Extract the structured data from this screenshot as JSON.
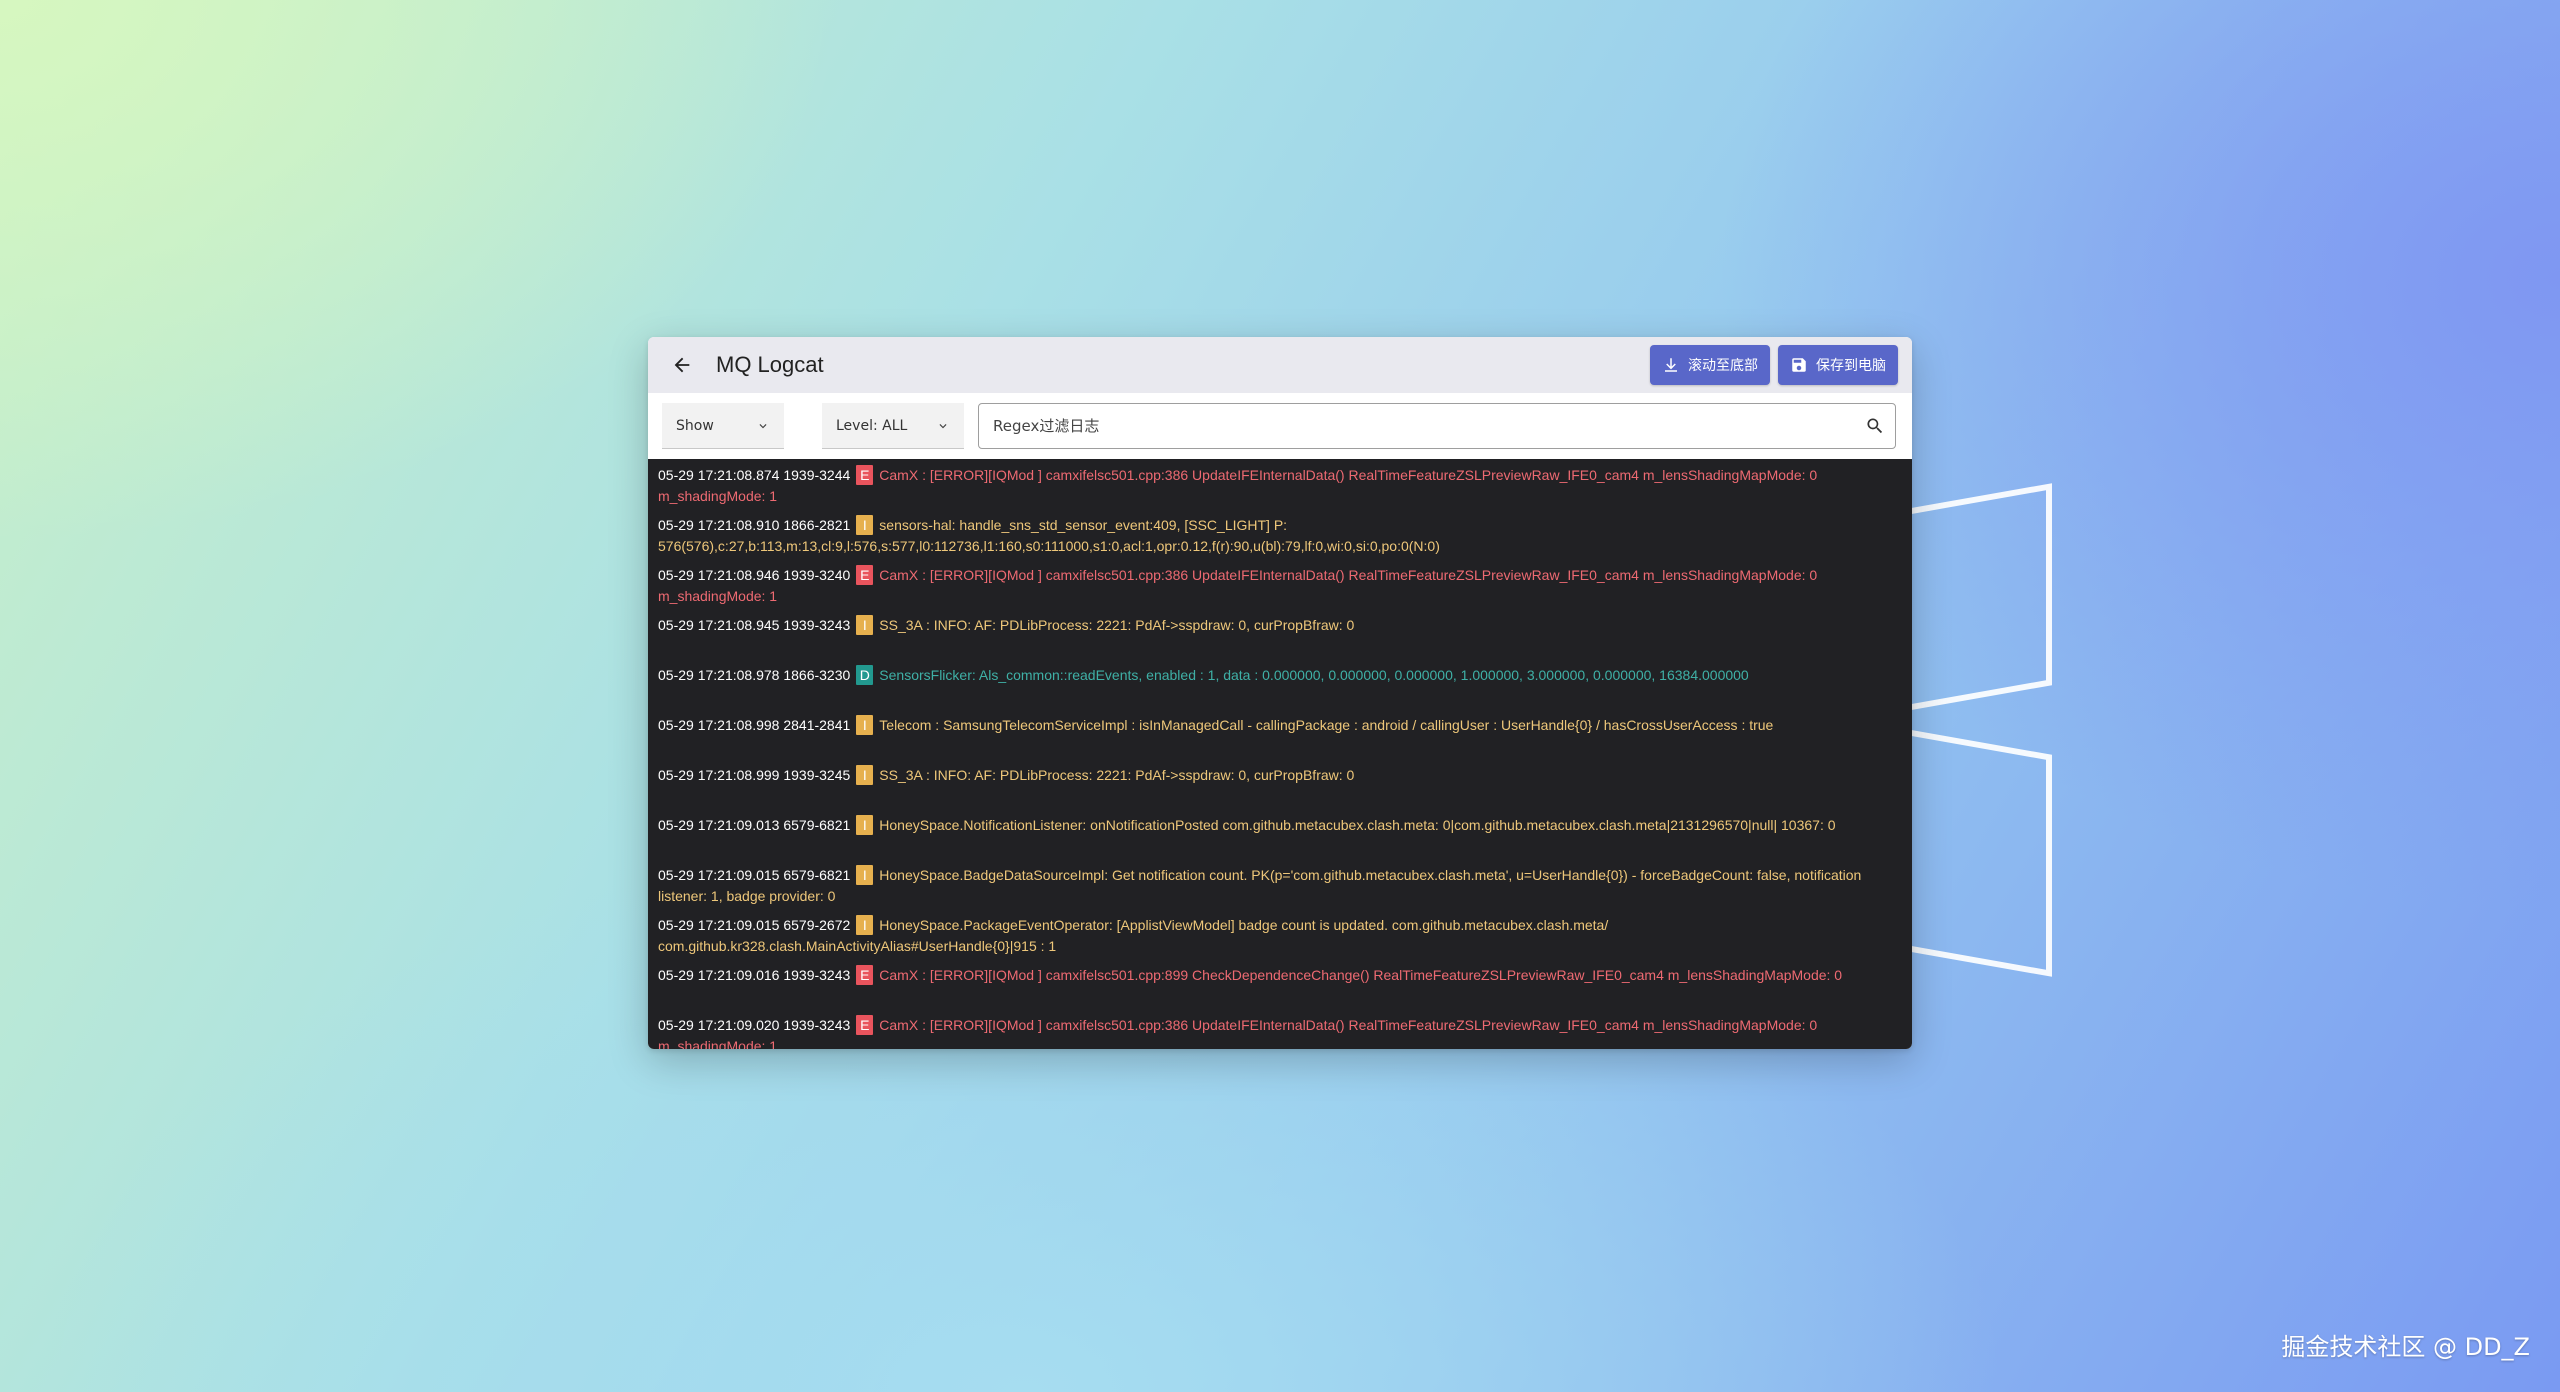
{
  "window": {
    "title": "MQ Logcat",
    "buttons": {
      "scroll_bottom": "滚动至底部",
      "save_pc": "保存到电脑"
    }
  },
  "toolbar": {
    "show_select": "Show",
    "level_select": "Level:  ALL",
    "search_placeholder": "Regex过滤日志"
  },
  "colors": {
    "error": "#e9545d",
    "info": "#e6b04e",
    "debug": "#22998f",
    "accent_button": "#5967c9",
    "log_background": "#212124"
  },
  "logs": [
    {
      "ts": "05-29 17:21:08.874 1939-3244",
      "level": "E",
      "msg": "CamX     : [ERROR][IQMod  ] camxifelsc501.cpp:386 UpdateIFEInternalData() RealTimeFeatureZSLPreviewRaw_IFE0_cam4 m_lensShadingMapMode: 0 m_shadingMode: 1"
    },
    {
      "ts": "05-29 17:21:08.910 1866-2821",
      "level": "I",
      "msg": "sensors-hal: handle_sns_std_sensor_event:409, [SSC_LIGHT] P: 576(576),c:27,b:113,m:13,cl:9,l:576,s:577,l0:112736,l1:160,s0:111000,s1:0,acl:1,opr:0.12,f(r):90,u(bl):79,lf:0,wi:0,si:0,po:0(N:0)"
    },
    {
      "ts": "05-29 17:21:08.946 1939-3240",
      "level": "E",
      "msg": "CamX     : [ERROR][IQMod  ] camxifelsc501.cpp:386 UpdateIFEInternalData() RealTimeFeatureZSLPreviewRaw_IFE0_cam4 m_lensShadingMapMode: 0 m_shadingMode: 1"
    },
    {
      "ts": "05-29 17:21:08.945 1939-3243",
      "level": "I",
      "msg": "SS_3A    :  INFO:  AF: PDLibProcess: 2221: PdAf->sspdraw: 0, curPropBfraw: 0"
    },
    {
      "ts": "05-29 17:21:08.978 1866-3230",
      "level": "D",
      "msg": "SensorsFlicker: Als_common::readEvents, enabled : 1, data : 0.000000, 0.000000, 0.000000, 1.000000, 3.000000, 0.000000, 16384.000000"
    },
    {
      "ts": "05-29 17:21:08.998 2841-2841",
      "level": "I",
      "msg": "Telecom : SamsungTelecomServiceImpl : isInManagedCall - callingPackage : android / callingUser : UserHandle{0} / hasCrossUserAccess : true"
    },
    {
      "ts": "05-29 17:21:08.999 1939-3245",
      "level": "I",
      "msg": "SS_3A    :  INFO:  AF: PDLibProcess: 2221: PdAf->sspdraw: 0, curPropBfraw: 0"
    },
    {
      "ts": "05-29 17:21:09.013 6579-6821",
      "level": "I",
      "msg": "HoneySpace.NotificationListener: onNotificationPosted com.github.metacubex.clash.meta: 0|com.github.metacubex.clash.meta|2131296570|null| 10367: 0"
    },
    {
      "ts": "05-29 17:21:09.015 6579-6821",
      "level": "I",
      "msg": "HoneySpace.BadgeDataSourceImpl: Get notification count. PK(p='com.github.metacubex.clash.meta', u=UserHandle{0}) - forceBadgeCount: false, notification listener: 1, badge provider: 0"
    },
    {
      "ts": "05-29 17:21:09.015 6579-2672",
      "level": "I",
      "msg": "HoneySpace.PackageEventOperator: [ApplistViewModel] badge count is updated. com.github.metacubex.clash.meta/ com.github.kr328.clash.MainActivityAlias#UserHandle{0}|915 : 1"
    },
    {
      "ts": "05-29 17:21:09.016 1939-3243",
      "level": "E",
      "msg": "CamX     : [ERROR][IQMod  ] camxifelsc501.cpp:899 CheckDependenceChange() RealTimeFeatureZSLPreviewRaw_IFE0_cam4 m_lensShadingMapMode: 0"
    },
    {
      "ts": "05-29 17:21:09.020 1939-3243",
      "level": "E",
      "msg": "CamX     : [ERROR][IQMod  ] camxifelsc501.cpp:386 UpdateIFEInternalData() RealTimeFeatureZSLPreviewRaw_IFE0_cam4 m_lensShadingMapMode: 0 m_shadingMode: 1"
    }
  ],
  "watermark": "掘金技术社区 @ DD_Z"
}
